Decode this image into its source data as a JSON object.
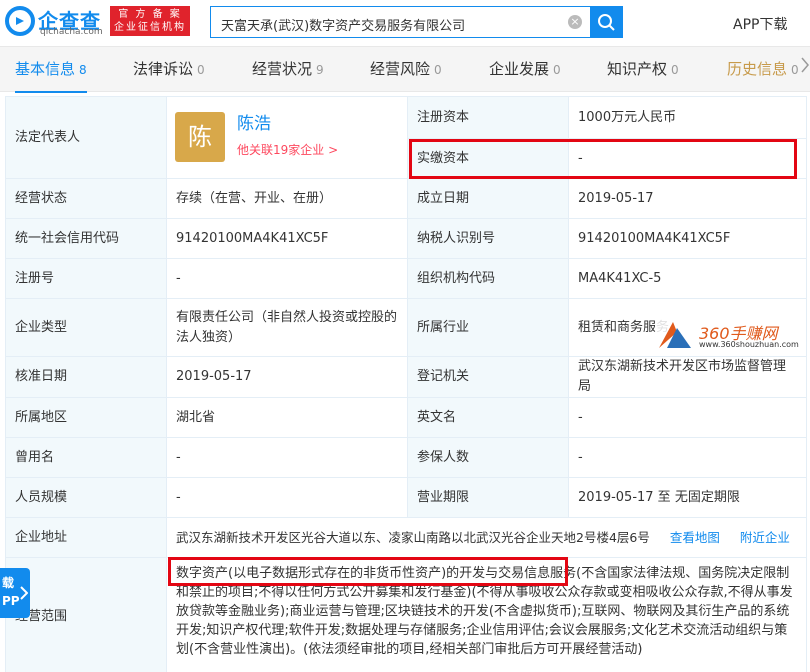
{
  "header": {
    "logo_text": "企查查",
    "logo_domain": "qichacha.com",
    "badge_line1": "官 方 备 案",
    "badge_line2": "企业征信机构",
    "search_value": "天富天承(武汉)数字资产交易服务有限公司",
    "app_download": "APP下载"
  },
  "tabs": [
    {
      "label": "基本信息",
      "count": "8"
    },
    {
      "label": "法律诉讼",
      "count": "0"
    },
    {
      "label": "经营状况",
      "count": "9"
    },
    {
      "label": "经营风险",
      "count": "0"
    },
    {
      "label": "企业发展",
      "count": "0"
    },
    {
      "label": "知识产权",
      "count": "0"
    },
    {
      "label": "历史信息",
      "count": "0"
    }
  ],
  "info": {
    "legal_rep_label": "法定代表人",
    "legal_rep_avatar": "陈",
    "legal_rep_name": "陈浩",
    "legal_rep_assoc": "他关联19家企业 >",
    "reg_capital_label": "注册资本",
    "reg_capital": "1000万元人民币",
    "paid_capital_label": "实缴资本",
    "paid_capital": "-",
    "status_label": "经营状态",
    "status": "存续（在营、开业、在册）",
    "est_date_label": "成立日期",
    "est_date": "2019-05-17",
    "credit_code_label": "统一社会信用代码",
    "credit_code": "91420100MA4K41XC5F",
    "taxpayer_label": "纳税人识别号",
    "taxpayer": "91420100MA4K41XC5F",
    "reg_no_label": "注册号",
    "reg_no": "-",
    "org_code_label": "组织机构代码",
    "org_code": "MA4K41XC-5",
    "type_label": "企业类型",
    "type": "有限责任公司（非自然人投资或控股的法人独资）",
    "industry_label": "所属行业",
    "industry": "租赁和商务服务",
    "approve_date_label": "核准日期",
    "approve_date": "2019-05-17",
    "authority_label": "登记机关",
    "authority": "武汉东湖新技术开发区市场监督管理局",
    "region_label": "所属地区",
    "region": "湖北省",
    "en_name_label": "英文名",
    "en_name": "-",
    "former_name_label": "曾用名",
    "former_name": "-",
    "insured_label": "参保人数",
    "insured": "-",
    "staff_label": "人员规模",
    "staff": "-",
    "term_label": "营业期限",
    "term": "2019-05-17 至 无固定期限",
    "address_label": "企业地址",
    "address": "武汉东湖新技术开发区光谷大道以东、凌家山南路以北武汉光谷企业天地2号楼4层6号",
    "view_map": "查看地图",
    "nearby": "附近企业",
    "scope_label": "经营范围",
    "scope": "数字资产(以电子数据形式存在的非货币性资产)的开发与交易信息服务(不含国家法律法规、国务院决定限制和禁止的项目;不得以任何方式公开募集和发行基金)(不得从事吸收公众存款或变相吸收公众存款,不得从事发放贷款等金融业务);商业运营与管理;区块链技术的开发(不含虚拟货币);互联网、物联网及其衍生产品的系统开发;知识产权代理;软件开发;数据处理与存储服务;企业信用评估;会议会展服务;文化艺术交流活动组织与策划(不含营业性演出)。(依法须经审批的项目,经相关部门审批后方可开展经营活动)"
  },
  "watermark": {
    "name": "360手赚网",
    "url": "www.360shouzhuan.com"
  },
  "side_tab": {
    "line1": "载",
    "line2": "PP"
  },
  "colors": {
    "brand_blue": "#128bed",
    "highlight_red": "#e30613",
    "label_bg": "#f2f9fc",
    "history_gold": "#c79a4a"
  }
}
